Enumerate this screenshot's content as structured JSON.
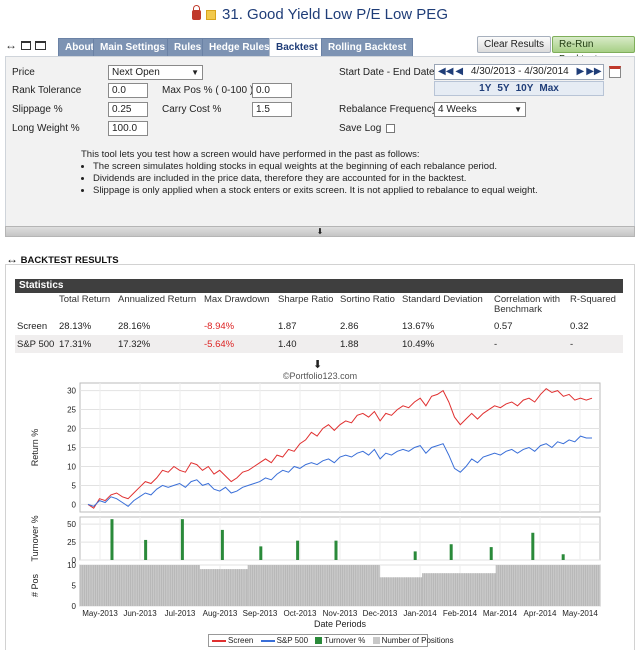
{
  "title": "31. Good Yield Low P/E Low PEG",
  "tabs": [
    {
      "label": "About",
      "active": false
    },
    {
      "label": "Main Settings",
      "active": false
    },
    {
      "label": "Rules",
      "active": false
    },
    {
      "label": "Hedge Rules",
      "active": false
    },
    {
      "label": "Backtest",
      "active": true
    },
    {
      "label": "Rolling Backtest",
      "active": false
    }
  ],
  "buttons": {
    "clear": "Clear Results",
    "rerun": "Re-Run Backtest"
  },
  "form": {
    "price_label": "Price",
    "price_value": "Next Open",
    "rank_tol_label": "Rank Tolerance",
    "rank_tol_value": "0.0",
    "maxpos_label": "Max Pos % ( 0-100 )",
    "maxpos_value": "0.0",
    "slippage_label": "Slippage %",
    "slippage_value": "0.25",
    "carry_label": "Carry Cost %",
    "carry_value": "1.5",
    "longw_label": "Long Weight %",
    "longw_value": "100.0",
    "dates_label": "Start Date - End Date",
    "dates_value": "4/30/2013 - 4/30/2014",
    "ranges": [
      "1Y",
      "5Y",
      "10Y",
      "Max"
    ],
    "rebal_label": "Rebalance Frequency",
    "rebal_value": "4 Weeks",
    "savelog_label": "Save Log"
  },
  "description": {
    "intro": "This tool lets you test how a screen would have performed in the past as follows:",
    "bullets": [
      "The screen simulates holding stocks in equal weights at the beginning of each rebalance period.",
      "Dividends are included in the price data, therefore they are accounted for in the backtest.",
      "Slippage is only applied when a stock enters or exits screen. It is not applied to rebalance to equal weight."
    ]
  },
  "results": {
    "header": "BACKTEST RESULTS",
    "stats_title": "Statistics",
    "columns": [
      "",
      "Total Return",
      "Annualized Return",
      "Max Drawdown",
      "Sharpe Ratio",
      "Sortino Ratio",
      "Standard Deviation",
      "Correlation with Benchmark",
      "R-Squared"
    ],
    "rows": [
      {
        "name": "Screen",
        "total": "28.13%",
        "annual": "28.16%",
        "maxdd": "-8.94%",
        "sharpe": "1.87",
        "sortino": "2.86",
        "stdev": "13.67%",
        "corr": "0.57",
        "r2": "0.32"
      },
      {
        "name": "S&P 500",
        "total": "17.31%",
        "annual": "17.32%",
        "maxdd": "-5.64%",
        "sharpe": "1.40",
        "sortino": "1.88",
        "stdev": "10.49%",
        "corr": "-",
        "r2": "-"
      }
    ],
    "copyright": "©Portfolio123.com"
  },
  "chart_data": {
    "type": "line",
    "xlabel": "Date Periods",
    "x_ticks": [
      "May-2013",
      "Jun-2013",
      "Jul-2013",
      "Aug-2013",
      "Sep-2013",
      "Oct-2013",
      "Nov-2013",
      "Dec-2013",
      "Jan-2014",
      "Feb-2014",
      "Mar-2014",
      "Apr-2014",
      "May-2014"
    ],
    "panels": [
      {
        "ylabel": "Return %",
        "ylim": [
          -2,
          32
        ],
        "yticks": [
          0,
          5,
          10,
          15,
          20,
          25,
          30
        ],
        "series": [
          {
            "name": "Screen",
            "color": "#e03030",
            "values": [
              0,
              -1,
              1.5,
              1,
              2.5,
              3,
              2,
              1.5,
              3,
              4.5,
              6,
              5.5,
              7,
              9,
              8.5,
              10,
              9,
              8.5,
              11,
              10.5,
              9,
              10,
              8,
              9,
              7.5,
              6,
              7,
              8.5,
              9,
              10,
              11,
              12,
              11,
              13,
              12.5,
              14.5,
              14,
              16,
              17,
              19,
              18,
              20,
              21,
              19.5,
              21,
              22,
              21.5,
              23.5,
              24,
              23,
              24.5,
              22,
              24,
              23.5,
              25,
              26,
              25.5,
              27,
              28,
              26,
              28.5,
              29,
              30,
              27,
              23,
              21,
              22.5,
              24,
              22.5,
              24,
              25,
              26,
              25.5,
              26.5,
              27,
              26,
              27.5,
              28,
              27,
              29,
              30.5,
              29.5,
              30,
              28.5,
              29,
              27.5,
              28,
              27.5,
              28
            ]
          },
          {
            "name": "S&P 500",
            "color": "#3a6fd8",
            "values": [
              0,
              -0.5,
              1,
              0.5,
              2,
              1.5,
              0.5,
              -0.5,
              1,
              2,
              3,
              2.5,
              4,
              5,
              4.5,
              5,
              5.5,
              4.5,
              6,
              6.5,
              5,
              5.5,
              4,
              3.5,
              4.5,
              3,
              3.5,
              4.5,
              5,
              5.5,
              6,
              7,
              6.5,
              8,
              9,
              8.5,
              10,
              9.5,
              10.5,
              11,
              10.5,
              11.5,
              12,
              11,
              12.5,
              13,
              12.5,
              13.5,
              14,
              13,
              14.5,
              12,
              13.5,
              13,
              14,
              14.5,
              14,
              15,
              15.5,
              13.5,
              15,
              15.5,
              16,
              13,
              9.5,
              8.5,
              10,
              12,
              11,
              12.5,
              13,
              13.5,
              13,
              14,
              14.5,
              13.5,
              14.5,
              15,
              14,
              15.5,
              16,
              15,
              16.5,
              16,
              17,
              16.5,
              18,
              17.5,
              17.5
            ]
          }
        ]
      },
      {
        "ylabel": "Turnover %",
        "ylim": [
          0,
          60
        ],
        "yticks": [
          0,
          25,
          50
        ],
        "series": [
          {
            "name": "Turnover %",
            "color": "#2a8a3a",
            "positions": [
              0.0615,
              0.1262,
              0.1969,
              0.2738,
              0.3477,
              0.4185,
              0.4923,
              0.6446,
              0.7138,
              0.7908,
              0.8708,
              0.9292
            ],
            "values": [
              57,
              28,
              57,
              42,
              19,
              27,
              27,
              12,
              22,
              18,
              38,
              8
            ]
          }
        ]
      },
      {
        "ylabel": "# Pos",
        "ylim": [
          0,
          10
        ],
        "yticks": [
          0,
          5,
          10
        ],
        "series": [
          {
            "name": "Number of Positions",
            "color": "#c8c8c8",
            "segments": [
              [
                0.0,
                0.2308,
                10
              ],
              [
                0.2308,
                0.3231,
                9
              ],
              [
                0.3231,
                0.5769,
                10
              ],
              [
                0.5769,
                0.6585,
                7
              ],
              [
                0.6585,
                0.8,
                8
              ],
              [
                0.8,
                0.8877,
                10
              ],
              [
                0.8877,
                1.0,
                10
              ]
            ]
          }
        ]
      }
    ],
    "legend": [
      "Screen",
      "S&P 500",
      "Turnover %",
      "Number of Positions"
    ]
  }
}
